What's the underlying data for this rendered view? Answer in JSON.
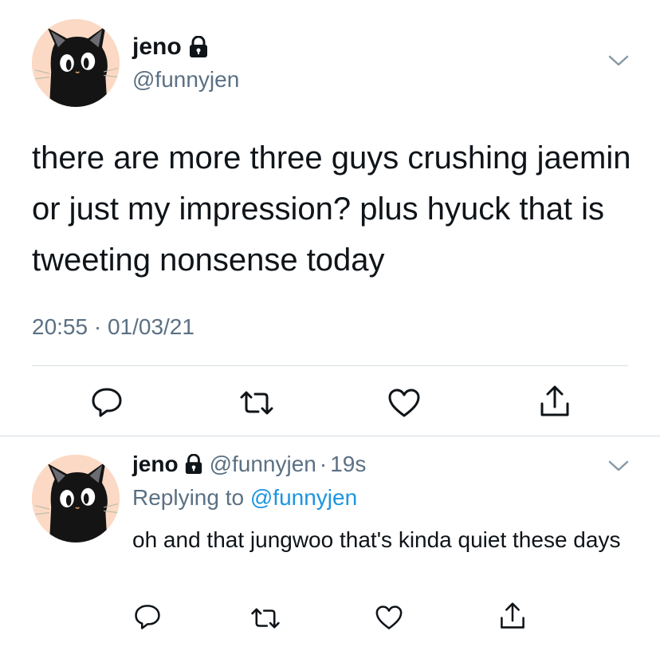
{
  "main_tweet": {
    "display_name": "jeno",
    "handle": "@funnyjen",
    "text": "there are more three guys crushing jaemin or just my impression? plus hyuck that is tweeting nonsense today",
    "timestamp": "20:55 · 01/03/21",
    "avatar_icon": "black-cat-avatar",
    "lock_icon": "lock-icon",
    "menu_icon": "chevron-down-icon",
    "actions": [
      "reply-icon",
      "retweet-icon",
      "like-icon",
      "share-icon"
    ]
  },
  "reply_tweet": {
    "display_name": "jeno",
    "handle": "@funnyjen",
    "separator": "·",
    "time_ago": "19s",
    "replying_prefix": "Replying to",
    "replying_to": "@funnyjen",
    "text": "oh and that jungwoo that's kinda quiet these days",
    "avatar_icon": "black-cat-avatar",
    "lock_icon": "lock-icon",
    "menu_icon": "chevron-down-icon",
    "actions": [
      "reply-icon",
      "retweet-icon",
      "like-icon",
      "share-icon"
    ]
  },
  "colors": {
    "text": "#0f1419",
    "secondary": "#5b7083",
    "link": "#1b95e0",
    "divider": "#d6dde3",
    "avatar_bg": "#fbd9c4"
  }
}
